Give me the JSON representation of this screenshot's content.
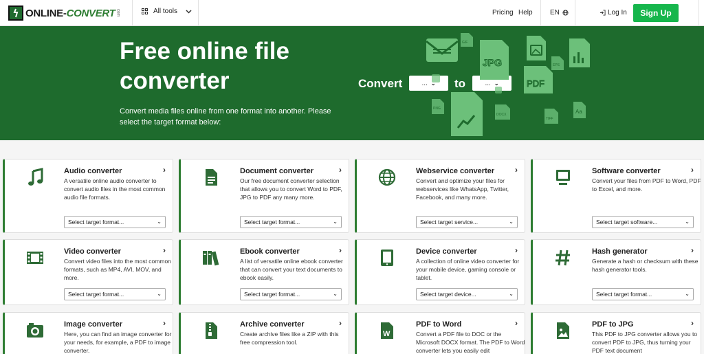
{
  "header": {
    "logo_text_a": "ONLINE-",
    "logo_text_b": "CONVERT",
    "logo_com": "com",
    "all_tools": "All tools",
    "pricing": "Pricing",
    "help": "Help",
    "lang": "EN",
    "login": "Log In",
    "signup": "Sign Up"
  },
  "hero": {
    "title": "Free online file converter",
    "subtitle": "Convert media files online from one format into another. Please select the target format below:",
    "convert_label": "Convert",
    "to_label": "to",
    "from_value": "...",
    "to_value": "...",
    "art_labels": {
      "jpg": "JPG",
      "pdf": "PDF",
      "gif": "GIF",
      "png": "PNG",
      "docx": "DOCX",
      "tiff": "TIFF",
      "eps": "EPS",
      "aa": "Aa"
    }
  },
  "colors": {
    "brand_green": "#1e6b2d",
    "signup_green": "#16b64c",
    "icon_green": "#2e6b36"
  },
  "cards": [
    {
      "title": "Audio converter",
      "desc": "A versatile online audio converter to convert audio files in the most common audio file formats.",
      "select": "Select target format...",
      "icon": "music-note-icon"
    },
    {
      "title": "Document converter",
      "desc": "Our free document converter selection that allows you to convert Word to PDF, JPG to PDF any many more.",
      "select": "Select target format...",
      "icon": "document-icon"
    },
    {
      "title": "Webservice converter",
      "desc": "Convert and optimize your files for webservices like WhatsApp, Twitter, Facebook, and many more.",
      "select": "Select target service...",
      "icon": "globe-icon"
    },
    {
      "title": "Software converter",
      "desc": "Convert your files from PDF to Word, PDF to Excel, and more.",
      "select": "Select target software...",
      "icon": "monitor-icon"
    },
    {
      "title": "Video converter",
      "desc": "Convert video files into the most common formats, such as MP4, AVI, MOV, and more.",
      "select": "Select target format...",
      "icon": "film-icon"
    },
    {
      "title": "Ebook converter",
      "desc": "A list of versatile online ebook converter that can convert your text documents to ebook easily.",
      "select": "Select target format...",
      "icon": "books-icon"
    },
    {
      "title": "Device converter",
      "desc": "A collection of online video converter for your mobile device, gaming console or tablet.",
      "select": "Select target device...",
      "icon": "tablet-icon"
    },
    {
      "title": "Hash generator",
      "desc": "Generate a hash or checksum with these hash generator tools.",
      "select": "Select target format...",
      "icon": "hash-icon"
    },
    {
      "title": "Image converter",
      "desc": "Here, you can find an image converter for your needs, for example, a PDF to image converter.",
      "select": "",
      "icon": "camera-icon"
    },
    {
      "title": "Archive converter",
      "desc": "Create archive files like a ZIP with this free compression tool.",
      "select": "",
      "icon": "zip-file-icon"
    },
    {
      "title": "PDF to Word",
      "desc": "Convert a PDF file to DOC or the Microsoft DOCX format. The PDF to Word converter lets you easily edit",
      "select": "",
      "icon": "word-file-icon"
    },
    {
      "title": "PDF to JPG",
      "desc": "This PDF to JPG converter allows you to convert PDF to JPG, thus turning your PDF text document",
      "select": "",
      "icon": "image-file-icon"
    }
  ]
}
